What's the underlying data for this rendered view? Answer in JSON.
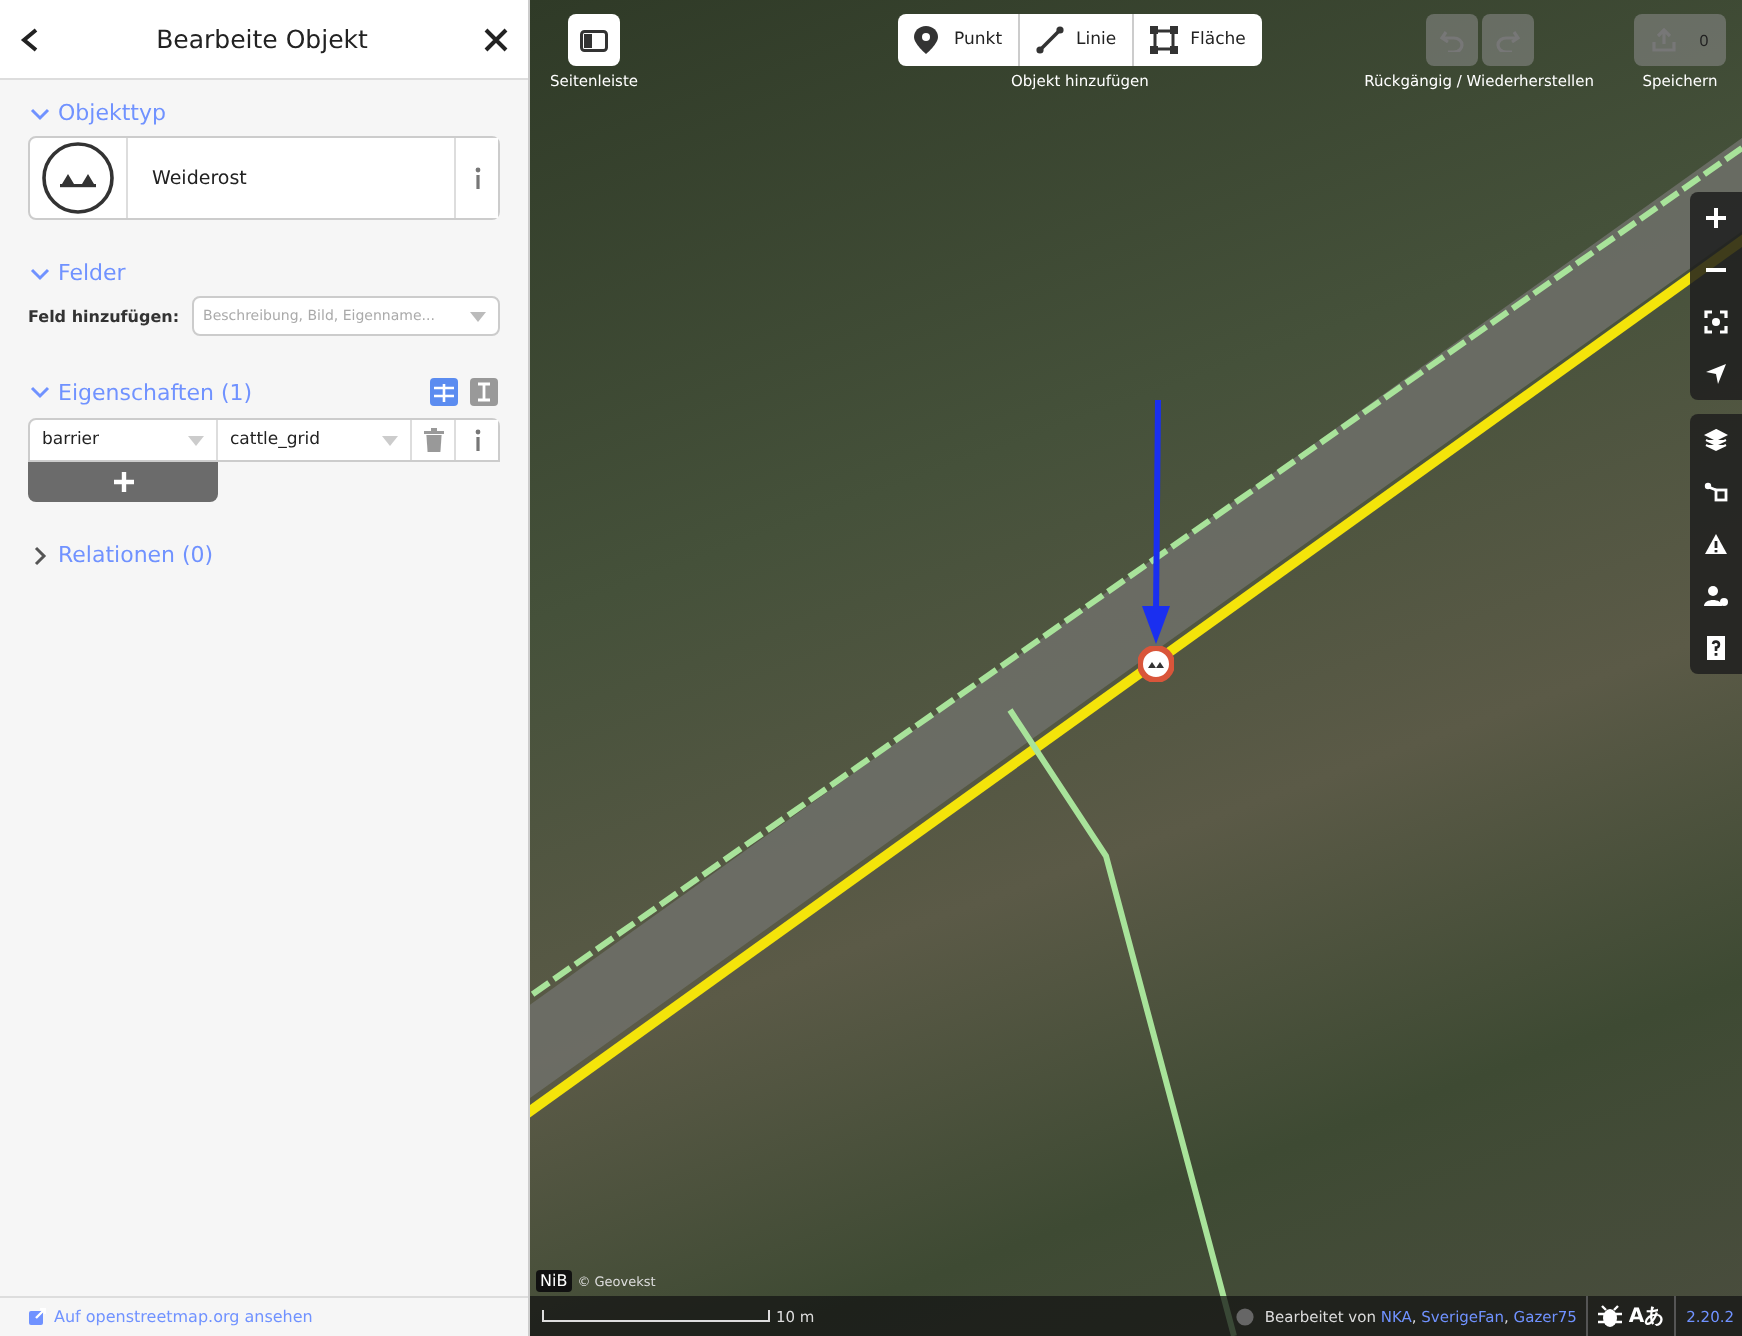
{
  "sidebar": {
    "header": {
      "title": "Bearbeite Objekt"
    },
    "sections": [
      {
        "kind": "preset",
        "title": "Objekttyp",
        "expanded": true,
        "preset": "Weiderost"
      },
      {
        "kind": "fields",
        "title": "Felder",
        "expanded": true,
        "label": "Feld hinzufügen:",
        "placeholder": "Beschreibung, Bild, Eigenname..."
      },
      {
        "kind": "tags",
        "title": "Eigenschaften (1)",
        "expanded": true,
        "view_modes": [
          {
            "kind": "list",
            "selected": true
          },
          {
            "kind": "text",
            "selected": false
          }
        ],
        "tags": [
          {
            "key": "barrier",
            "value": "cattle_grid"
          }
        ]
      },
      {
        "kind": "relations",
        "title": "Relationen (0)",
        "expanded": false
      }
    ],
    "footer_link": "Auf openstreetmap.org ansehen"
  },
  "map": {
    "toolbar": {
      "sidebar_label": "Seitenleiste",
      "add_label": "Objekt hinzufügen",
      "modes": [
        {
          "kind": "point",
          "label": "Punkt"
        },
        {
          "kind": "line",
          "label": "Linie"
        },
        {
          "kind": "area",
          "label": "Fläche"
        }
      ],
      "undo_label": "Rückgängig / Wiederherstellen",
      "undo_disabled": true,
      "save_label": "Speichern",
      "save_count": "0",
      "save_disabled": true
    },
    "attribution": {
      "logo": "NiB",
      "text": "© Geovekst"
    },
    "scale": "10 m",
    "footer": {
      "edited_by": "Bearbeitet von",
      "users": [
        "NKA",
        "SverigeFan",
        "Gazer75"
      ],
      "separator": ", ",
      "translate": "Aあ",
      "version": "2.20.2"
    }
  }
}
